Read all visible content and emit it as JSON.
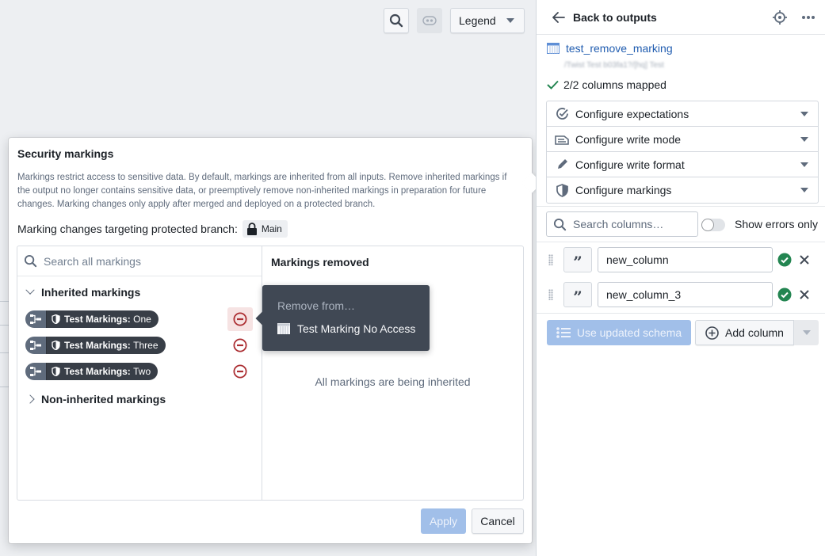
{
  "toolbar": {
    "search_icon": "search-icon",
    "view_icon": "eye-toggle-icon",
    "legend_label": "Legend"
  },
  "dialog": {
    "title": "Security markings",
    "description": "Markings restrict access to sensitive data. By default, markings are inherited from all inputs. Remove inherited markings if the output no longer contains sensitive data, or preemptively remove non-inherited markings in preparation for future changes. Marking changes only apply after merged and deployed on a protected branch.",
    "branch_label": "Marking changes targeting protected branch:",
    "branch_name": "Main",
    "search_placeholder": "Search all markings",
    "inherited_group": "Inherited markings",
    "non_inherited_group": "Non-inherited markings",
    "markings": [
      {
        "category": "Test Markings:",
        "name": "One",
        "hovered": true
      },
      {
        "category": "Test Markings:",
        "name": "Three",
        "hovered": false
      },
      {
        "category": "Test Markings:",
        "name": "Two",
        "hovered": false
      }
    ],
    "removed_title": "Markings removed",
    "empty_note": "All markings are being inherited",
    "apply_label": "Apply",
    "cancel_label": "Cancel"
  },
  "tooltip": {
    "heading": "Remove from…",
    "item": "Test Marking No Access"
  },
  "right_panel": {
    "back_label": "Back to outputs",
    "dataset_name": "test_remove_marking",
    "dataset_path_blurred": "/Twist Test b03fa1?/[hq] Test",
    "mapped_status": "2/2 columns mapped",
    "config_items": [
      {
        "label": "Configure expectations",
        "icon": "expectations-icon"
      },
      {
        "label": "Configure write mode",
        "icon": "write-mode-icon"
      },
      {
        "label": "Configure write format",
        "icon": "pencil-icon"
      },
      {
        "label": "Configure markings",
        "icon": "shield-icon"
      }
    ],
    "search_columns_placeholder": "Search columns…",
    "show_errors_label": "Show errors only",
    "show_errors_on": false,
    "columns": [
      {
        "type": "string",
        "name": "new_column",
        "valid": true
      },
      {
        "type": "string",
        "name": "new_column_3",
        "valid": true
      }
    ],
    "use_schema_label": "Use updated schema",
    "add_column_label": "Add column"
  },
  "colors": {
    "accent": "#215db0",
    "success": "#238551",
    "danger": "#ac2f33",
    "tooltip_bg": "#404854",
    "pill_bg": "#383e47",
    "disabled_primary": "#a1bfe9"
  }
}
